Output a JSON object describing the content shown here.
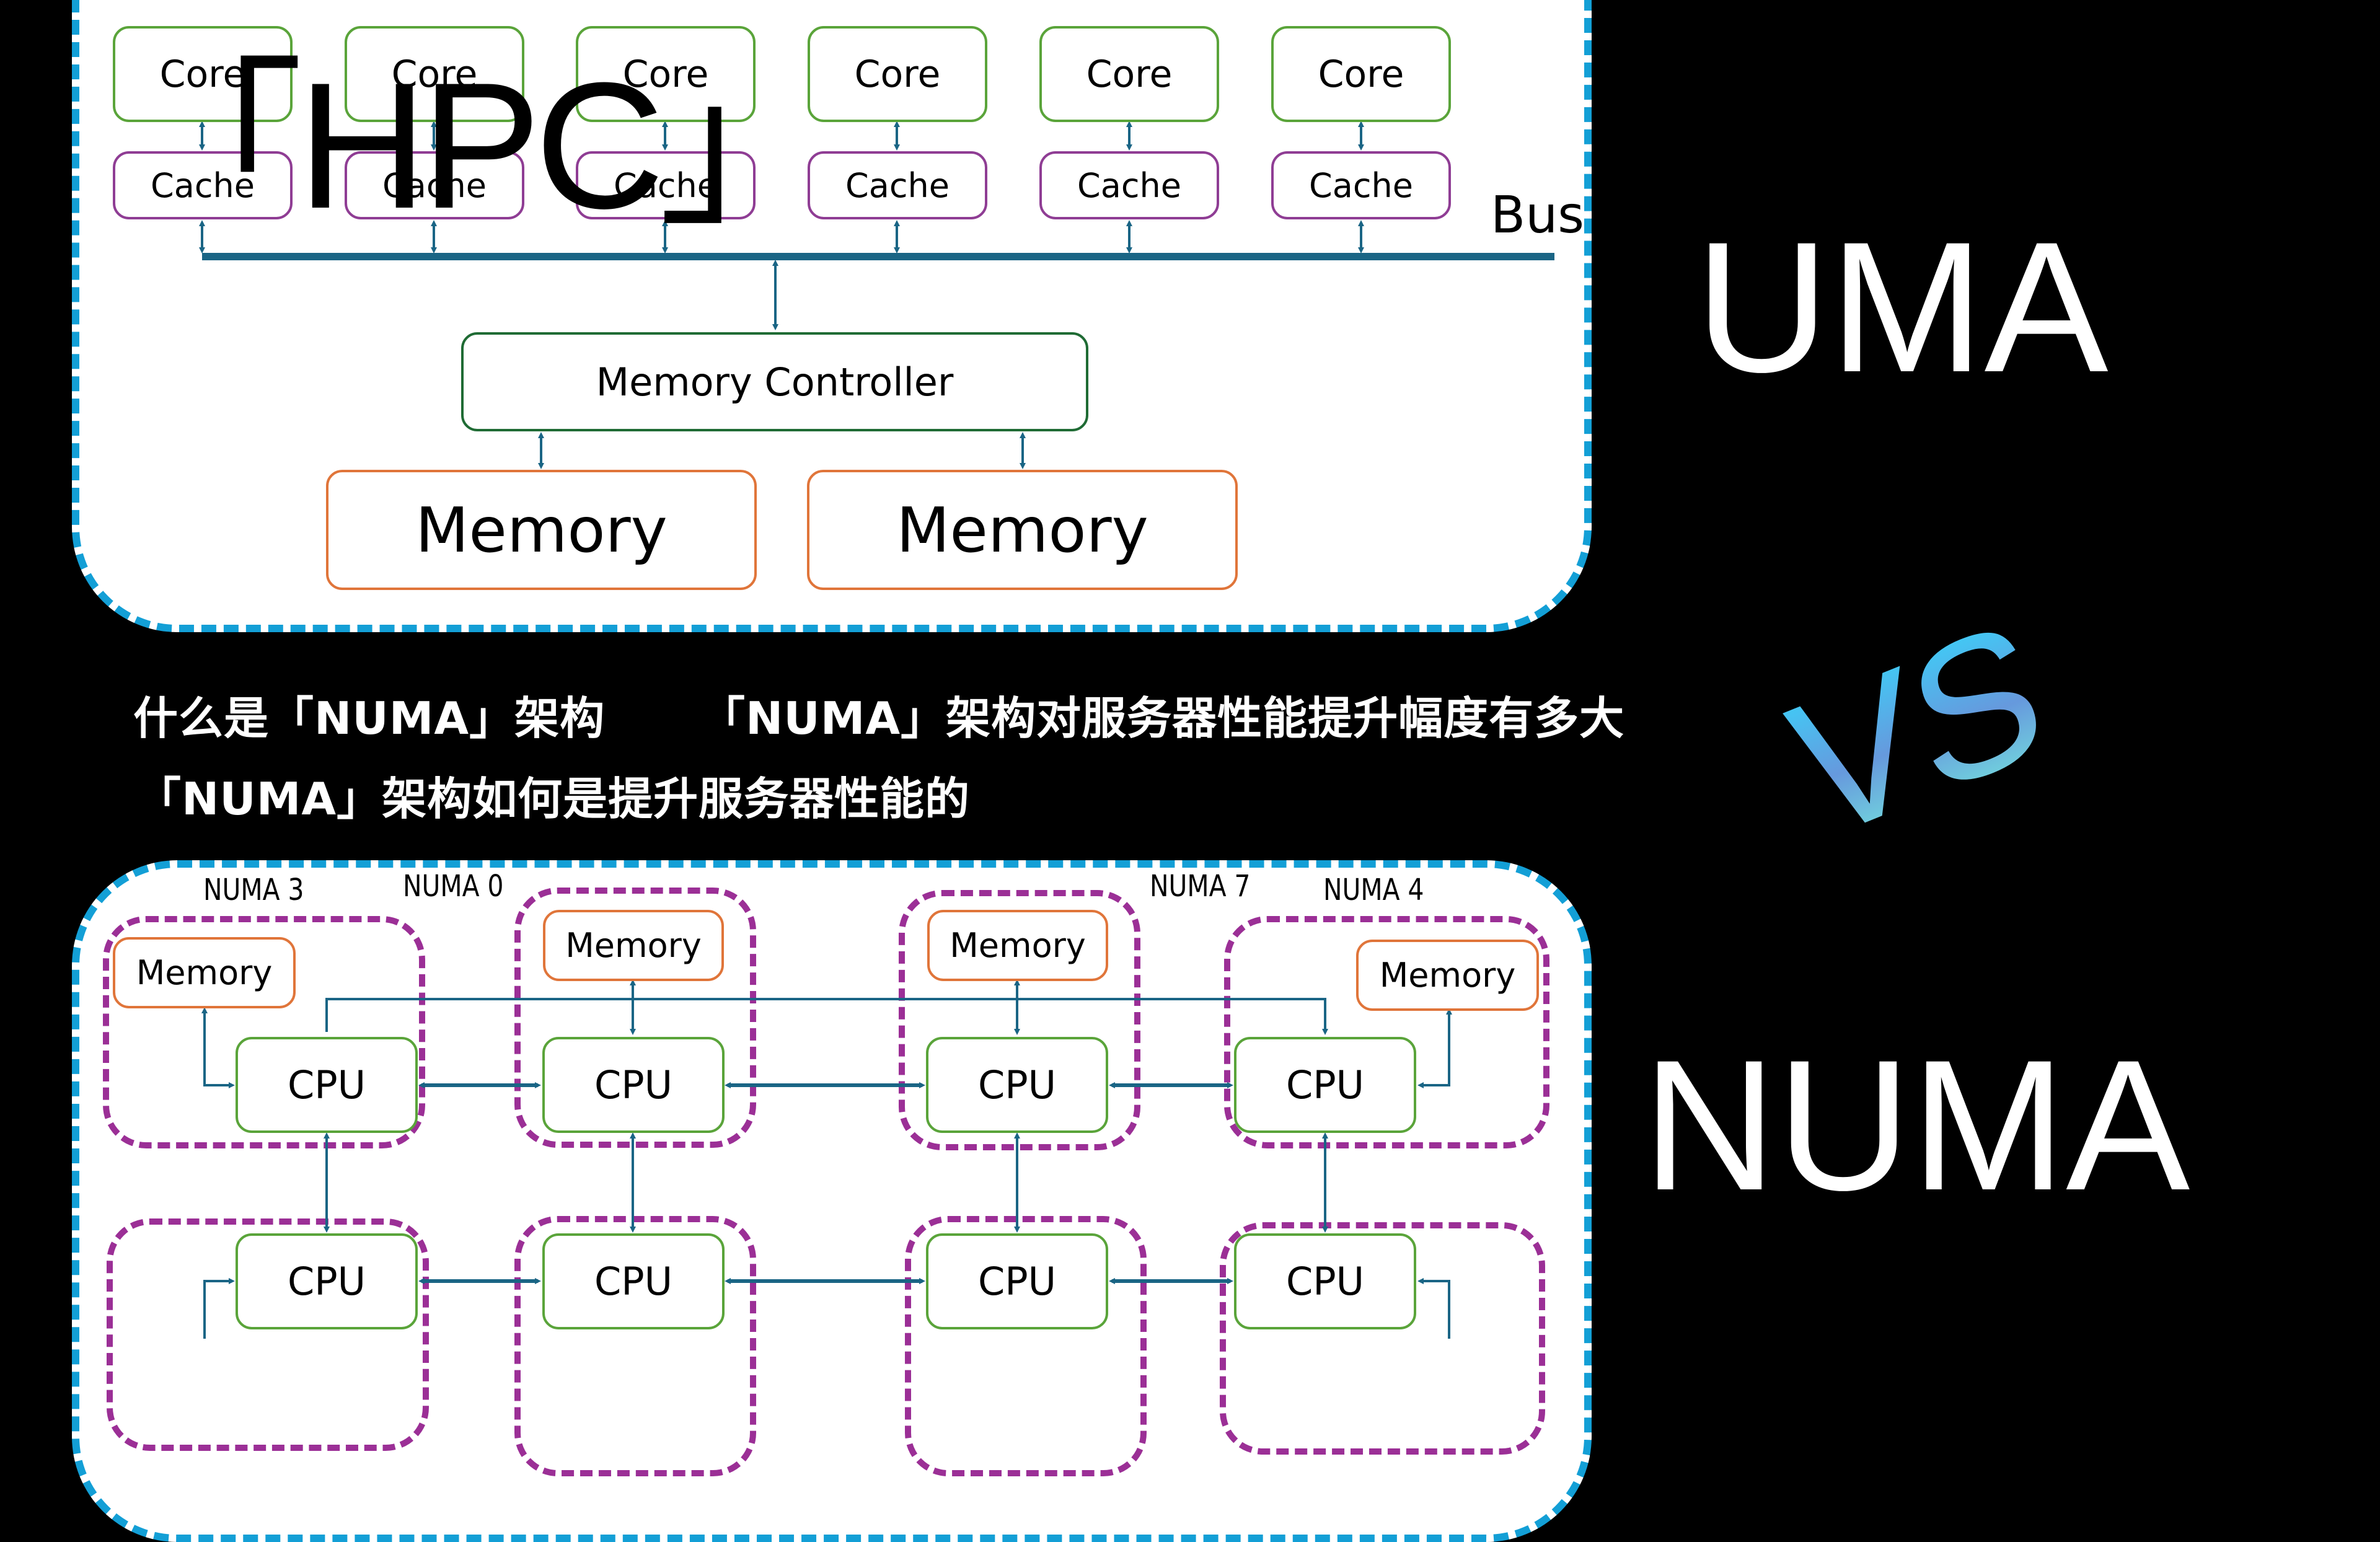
{
  "uma_diagram": {
    "cores": [
      "Core",
      "Core",
      "Core",
      "Core",
      "Core",
      "Core"
    ],
    "caches": [
      "Cache",
      "Cache",
      "Cache",
      "Cache",
      "Cache",
      "Cache"
    ],
    "bus_label": "Bus",
    "memory_controller": "Memory Controller",
    "memories": [
      "Memory",
      "Memory"
    ]
  },
  "overlay_title": "「HPC」",
  "labels": {
    "uma": "UMA",
    "vs": "VS",
    "numa": "NUMA"
  },
  "topics": [
    "什么是「NUMA」架构",
    "「NUMA」架构对服务器性能提升幅度有多大",
    "「NUMA」架构如何是提升服务器性能的"
  ],
  "numa_diagram": {
    "node_labels": [
      "NUMA 3",
      "NUMA 0",
      "NUMA 7",
      "NUMA 4"
    ],
    "top_row": [
      {
        "memory": "Memory",
        "cpu": "CPU"
      },
      {
        "memory": "Memory",
        "cpu": "CPU"
      },
      {
        "memory": "Memory",
        "cpu": "CPU"
      },
      {
        "memory": "Memory",
        "cpu": "CPU"
      }
    ],
    "bottom_row": [
      {
        "cpu": "CPU"
      },
      {
        "cpu": "CPU"
      },
      {
        "cpu": "CPU"
      },
      {
        "cpu": "CPU"
      }
    ]
  },
  "colors": {
    "panel_border": "#139fd6",
    "core_border": "#5aa43a",
    "cache_border": "#8f3d94",
    "memory_border": "#e0753a",
    "wire": "#1a6585",
    "numa_group_border": "#9b2f96",
    "vs_gradient": [
      "#33ddff",
      "#6699dd",
      "#77eedd"
    ]
  }
}
